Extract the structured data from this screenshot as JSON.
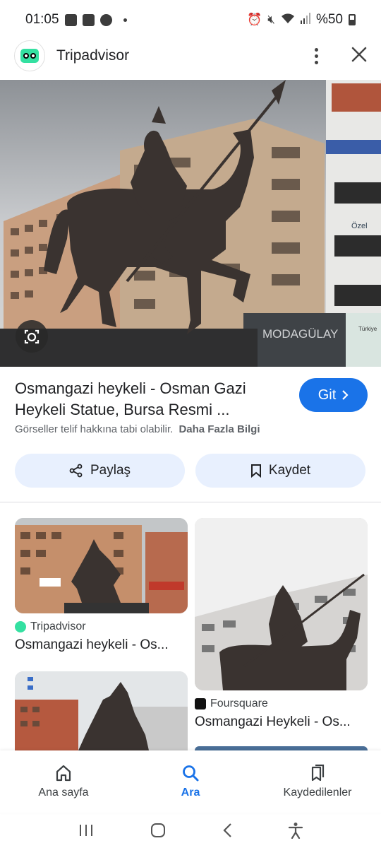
{
  "status_bar": {
    "time": "01:05",
    "battery": "%50"
  },
  "app_bar": {
    "title": "Tripadvisor",
    "logo_icon": "tripadvisor-owl-icon"
  },
  "hero": {
    "signs": {
      "modagulay": "MODAGÜLAY",
      "ozel": "Özel",
      "turkiye": "Türkiye"
    }
  },
  "result": {
    "title": "Osmangazi heykeli - Osman Gazi Heykeli Statue, Bursa Resmi ...",
    "go_label": "Git",
    "copyright": "Görseller telif hakkına tabi olabilir.",
    "learn_more": "Daha Fazla Bilgi",
    "share_label": "Paylaş",
    "save_label": "Kaydet"
  },
  "related": [
    {
      "source": "Tripadvisor",
      "title": "Osmangazi heykeli - Os..."
    },
    {
      "source": "Foursquare",
      "title": "Osmangazi Heykeli - Os..."
    }
  ],
  "colors": {
    "accent": "#1a73e8",
    "pill_bg": "#e8f0fe",
    "tripadvisor_green": "#34e0a1"
  },
  "bottom_nav": {
    "items": [
      {
        "label": "Ana sayfa",
        "icon": "home-icon"
      },
      {
        "label": "Ara",
        "icon": "search-icon",
        "active": true
      },
      {
        "label": "Kaydedilenler",
        "icon": "bookmarks-icon"
      }
    ]
  }
}
